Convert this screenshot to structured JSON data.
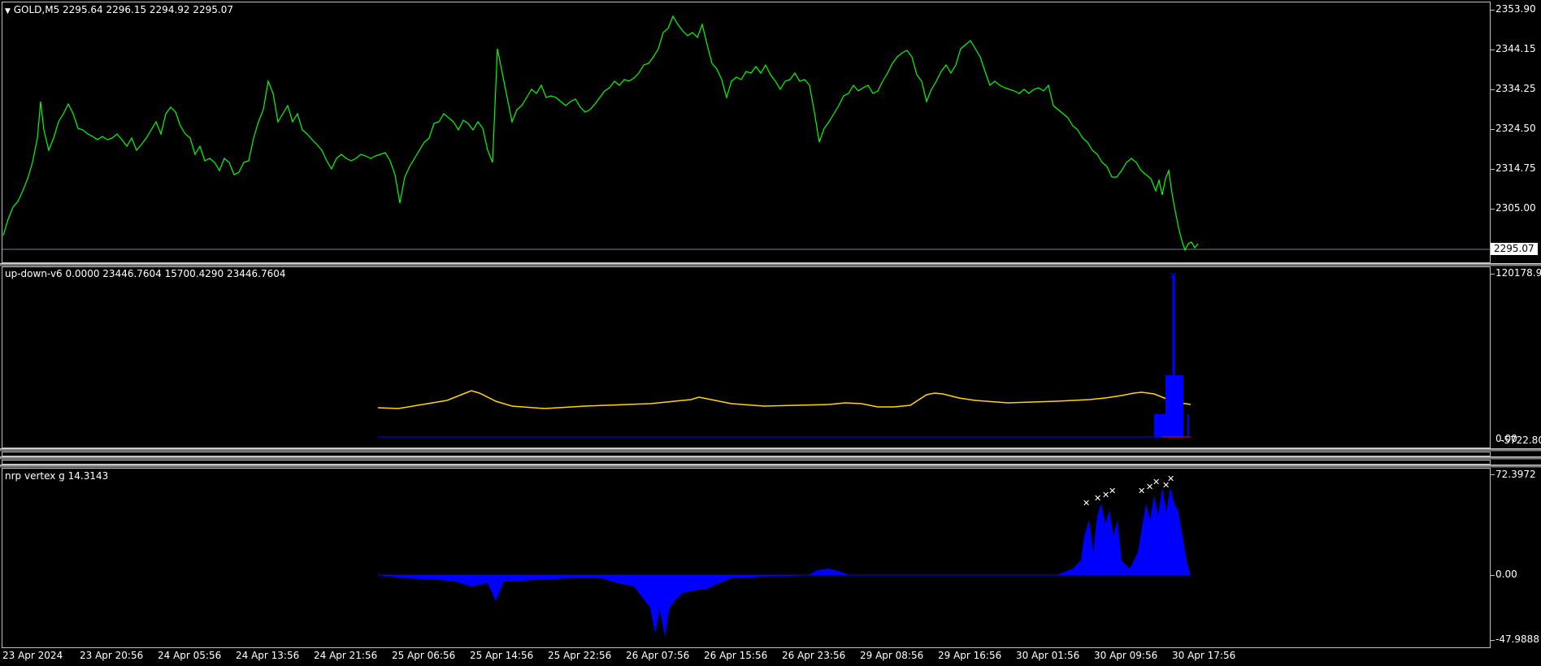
{
  "main_pane": {
    "title": "GOLD,M5  2295.64 2296.15 2294.92 2295.07",
    "price_levels": [
      "2353.90",
      "2344.15",
      "2334.25",
      "2324.50",
      "2314.75",
      "2305.00"
    ],
    "current_price": "2295.07",
    "line_color": "#00ff00"
  },
  "indicator1": {
    "title": "up-down-v6 0.0000 23446.7604 15700.4290 23446.7604",
    "top_value": "120178.93",
    "bottom_value": "0.00",
    "bottom_value2": "-5722.806",
    "line_color": "#ffd700",
    "hist_color": "#0000ff"
  },
  "indicator2": {
    "title": "nrp vertex g 14.3143",
    "top_value": "72.3972",
    "zero_value": "0.00",
    "bottom_value": "-47.9888",
    "hist_color": "#0000ff"
  },
  "time_axis": [
    "23 Apr 2024",
    "23 Apr 20:56",
    "24 Apr 05:56",
    "24 Apr 13:56",
    "24 Apr 21:56",
    "25 Apr 06:56",
    "25 Apr 14:56",
    "25 Apr 22:56",
    "26 Apr 07:56",
    "26 Apr 15:56",
    "26 Apr 23:56",
    "29 Apr 08:56",
    "29 Apr 16:56",
    "30 Apr 01:56",
    "30 Apr 09:56",
    "30 Apr 17:56"
  ]
}
